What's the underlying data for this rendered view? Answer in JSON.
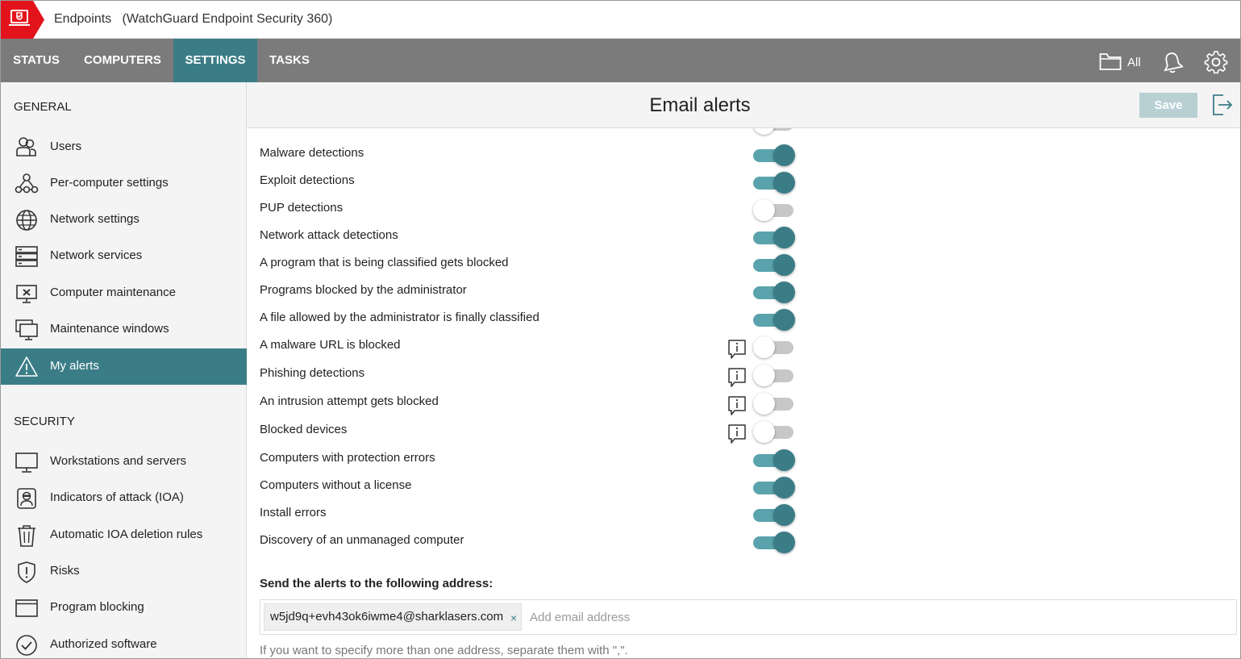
{
  "app": {
    "title": "Endpoints",
    "subtitle": "(WatchGuard Endpoint Security 360)"
  },
  "nav": {
    "tabs": [
      {
        "label": "STATUS",
        "active": false
      },
      {
        "label": "COMPUTERS",
        "active": false
      },
      {
        "label": "SETTINGS",
        "active": true
      },
      {
        "label": "TASKS",
        "active": false
      }
    ],
    "filter_label": "All",
    "icons": [
      "folder-icon",
      "bell-icon",
      "gear-icon"
    ]
  },
  "sidebar": {
    "general_heading": "GENERAL",
    "general_items": [
      {
        "label": "Users",
        "icon": "users-icon",
        "active": false
      },
      {
        "label": "Per-computer settings",
        "icon": "network-nodes-icon",
        "active": false
      },
      {
        "label": "Network settings",
        "icon": "globe-icon",
        "active": false
      },
      {
        "label": "Network services",
        "icon": "server-stack-icon",
        "active": false
      },
      {
        "label": "Computer maintenance",
        "icon": "monitor-x-icon",
        "active": false
      },
      {
        "label": "Maintenance windows",
        "icon": "monitors-icon",
        "active": false
      },
      {
        "label": "My alerts",
        "icon": "warning-icon",
        "active": true
      }
    ],
    "security_heading": "SECURITY",
    "security_items": [
      {
        "label": "Workstations and servers",
        "icon": "monitor-icon"
      },
      {
        "label": "Indicators of attack (IOA)",
        "icon": "attacker-icon"
      },
      {
        "label": "Automatic IOA deletion rules",
        "icon": "trash-icon"
      },
      {
        "label": "Risks",
        "icon": "shield-exclamation-icon"
      },
      {
        "label": "Program blocking",
        "icon": "window-icon"
      },
      {
        "label": "Authorized software",
        "icon": "check-circle-icon"
      }
    ]
  },
  "main": {
    "page_title": "Email alerts",
    "save_label": "Save",
    "alerts": [
      {
        "label": "Malware detections",
        "enabled": true,
        "info": false
      },
      {
        "label": "Exploit detections",
        "enabled": true,
        "info": false
      },
      {
        "label": "PUP detections",
        "enabled": false,
        "info": false
      },
      {
        "label": "Network attack detections",
        "enabled": true,
        "info": false
      },
      {
        "label": "A program that is being classified gets blocked",
        "enabled": true,
        "info": false
      },
      {
        "label": "Programs blocked by the administrator",
        "enabled": true,
        "info": false
      },
      {
        "label": "A file allowed by the administrator is finally classified",
        "enabled": true,
        "info": false
      },
      {
        "label": "A malware URL is blocked",
        "enabled": false,
        "info": true
      },
      {
        "label": "Phishing detections",
        "enabled": false,
        "info": true
      },
      {
        "label": "An intrusion attempt gets blocked",
        "enabled": false,
        "info": true
      },
      {
        "label": "Blocked devices",
        "enabled": false,
        "info": true
      },
      {
        "label": "Computers with protection errors",
        "enabled": true,
        "info": false
      },
      {
        "label": "Computers without a license",
        "enabled": true,
        "info": false
      },
      {
        "label": "Install errors",
        "enabled": true,
        "info": false
      },
      {
        "label": "Discovery of an unmanaged computer",
        "enabled": true,
        "info": false
      }
    ],
    "send_label": "Send the alerts to the following address:",
    "email_chip": "w5jd9q+evh43ok6iwme4@sharklasers.com",
    "email_chip_remove": "×",
    "email_placeholder": "Add email address",
    "hint": "If you want to specify more than one address, separate them with \",\"."
  },
  "colors": {
    "accent": "#3b7d87",
    "toggle_on_track": "#5aa3ac",
    "nav_bg": "#7b7b7b",
    "brand_red": "#e3131b"
  }
}
